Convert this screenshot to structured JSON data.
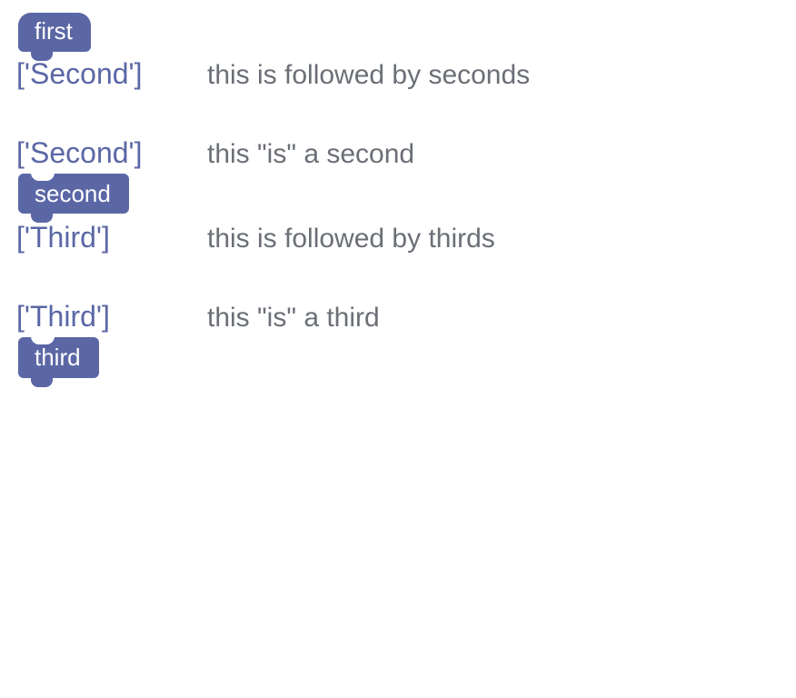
{
  "blocks": {
    "first": "first",
    "second": "second",
    "third": "third"
  },
  "rows": [
    {
      "tag": "['Second']",
      "desc": "this is followed by seconds"
    },
    {
      "tag": "['Second']",
      "desc": "this \"is\" a second"
    },
    {
      "tag": "['Third']",
      "desc": "this is followed by thirds"
    },
    {
      "tag": "['Third']",
      "desc": "this \"is\" a third"
    }
  ],
  "colors": {
    "block": "#5b67a5",
    "tag": "#5b67a5",
    "desc": "#6b6f76",
    "bg": "#ffffff"
  }
}
